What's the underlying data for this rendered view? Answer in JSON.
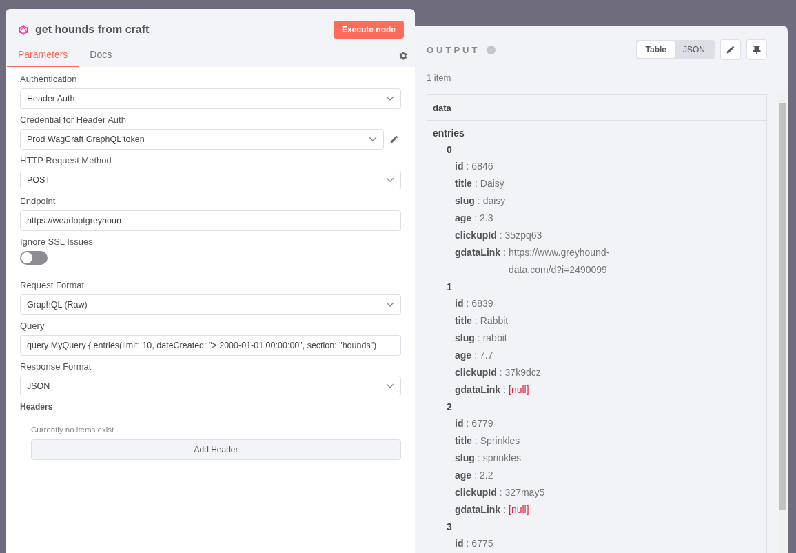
{
  "node": {
    "title": "get hounds from craft",
    "execute_button": "Execute node",
    "tabs": [
      {
        "label": "Parameters",
        "selected": true
      },
      {
        "label": "Docs",
        "selected": false
      }
    ],
    "fields": [
      {
        "kind": "select",
        "label": "Authentication",
        "value": "Header Auth"
      },
      {
        "kind": "credential",
        "label": "Credential for Header Auth",
        "value": "Prod WagCraft GraphQL token"
      },
      {
        "kind": "select",
        "label": "HTTP Request Method",
        "value": "POST"
      },
      {
        "kind": "input",
        "label": "Endpoint",
        "value": "https://weadoptgreyhoun"
      },
      {
        "kind": "toggle",
        "label": "Ignore SSL Issues",
        "on": false
      },
      {
        "kind": "select",
        "label": "Request Format",
        "value": "GraphQL (Raw)"
      },
      {
        "kind": "input",
        "label": "Query",
        "value": "query MyQuery {  entries(limit: 10, dateCreated: \"> 2000-01-01 00:00:00\", section: \"hounds\")"
      },
      {
        "kind": "select",
        "label": "Response Format",
        "value": "JSON"
      }
    ],
    "headers": {
      "title": "Headers",
      "empty_note": "Currently no items exist",
      "add_button": "Add Header"
    }
  },
  "output": {
    "title": "OUTPUT",
    "view_tabs": [
      {
        "label": "Table",
        "selected": true
      },
      {
        "label": "JSON",
        "selected": false
      }
    ],
    "count": "1 item",
    "column": "data",
    "separator": ":",
    "tree": {
      "label": "entries",
      "children": [
        {
          "label": "0",
          "fields": [
            {
              "key": "id",
              "value": "6846",
              "kind": "text"
            },
            {
              "key": "title",
              "value": "Daisy",
              "kind": "text"
            },
            {
              "key": "slug",
              "value": "daisy",
              "kind": "text"
            },
            {
              "key": "age",
              "value": "2.3",
              "kind": "text"
            },
            {
              "key": "clickupId",
              "value": "35zpq63",
              "kind": "text"
            },
            {
              "key": "gdataLink",
              "value": "https://www.greyhound-data.com/d?i=2490099",
              "kind": "text"
            }
          ]
        },
        {
          "label": "1",
          "fields": [
            {
              "key": "id",
              "value": "6839",
              "kind": "text"
            },
            {
              "key": "title",
              "value": "Rabbit",
              "kind": "text"
            },
            {
              "key": "slug",
              "value": "rabbit",
              "kind": "text"
            },
            {
              "key": "age",
              "value": "7.7",
              "kind": "text"
            },
            {
              "key": "clickupId",
              "value": "37k9dcz",
              "kind": "text"
            },
            {
              "key": "gdataLink",
              "value": "[null]",
              "kind": "null"
            }
          ]
        },
        {
          "label": "2",
          "fields": [
            {
              "key": "id",
              "value": "6779",
              "kind": "text"
            },
            {
              "key": "title",
              "value": "Sprinkles",
              "kind": "text"
            },
            {
              "key": "slug",
              "value": "sprinkles",
              "kind": "text"
            },
            {
              "key": "age",
              "value": "2.2",
              "kind": "text"
            },
            {
              "key": "clickupId",
              "value": "327may5",
              "kind": "text"
            },
            {
              "key": "gdataLink",
              "value": "[null]",
              "kind": "null"
            }
          ]
        },
        {
          "label": "3",
          "fields": [
            {
              "key": "id",
              "value": "6775",
              "kind": "text"
            }
          ]
        }
      ]
    }
  }
}
